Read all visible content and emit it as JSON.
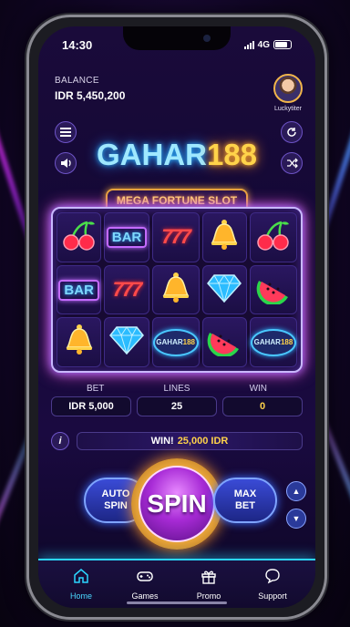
{
  "status": {
    "time": "14:30",
    "network": "4G"
  },
  "account": {
    "balance_label": "BALANCE",
    "balance_value": "IDR 5,450,200",
    "username": "Luckytiter"
  },
  "logo": {
    "part1": "GAHAR",
    "part2": "188"
  },
  "slot_title": "MEGA FORTUNE SLOT",
  "reels": [
    [
      "cherry",
      "bar",
      "bell"
    ],
    [
      "bar",
      "777",
      "diamond"
    ],
    [
      "777",
      "bell",
      "gahar188"
    ],
    [
      "bell",
      "diamond",
      "watermelon"
    ],
    [
      "cherry",
      "watermelon",
      "gahar188"
    ]
  ],
  "symbol_text": {
    "bar": "BAR",
    "777": "777",
    "gahar_a": "GAHAR",
    "gahar_b": "188"
  },
  "stats": {
    "bet_label": "BET",
    "lines_label": "LINES",
    "win_label": "WIN",
    "bet_value": "IDR 5,000",
    "lines_value": "25",
    "win_value": "0"
  },
  "win_banner": {
    "prefix": "WIN!",
    "amount": "25,000 IDR"
  },
  "controls": {
    "auto_line1": "AUTO",
    "auto_line2": "SPIN",
    "spin": "SPIN",
    "max_line1": "MAX",
    "max_line2": "BET"
  },
  "nav": [
    {
      "label": "Home",
      "icon": "home-icon",
      "active": true
    },
    {
      "label": "Games",
      "icon": "gamepad-icon",
      "active": false
    },
    {
      "label": "Promo",
      "icon": "gift-icon",
      "active": false
    },
    {
      "label": "Support",
      "icon": "chat-icon",
      "active": false
    }
  ],
  "colors": {
    "accent_cyan": "#2bd6ff",
    "accent_gold": "#ffd34a",
    "spin_purple": "#a82bd6",
    "bet_blue": "#3a4bd6"
  }
}
